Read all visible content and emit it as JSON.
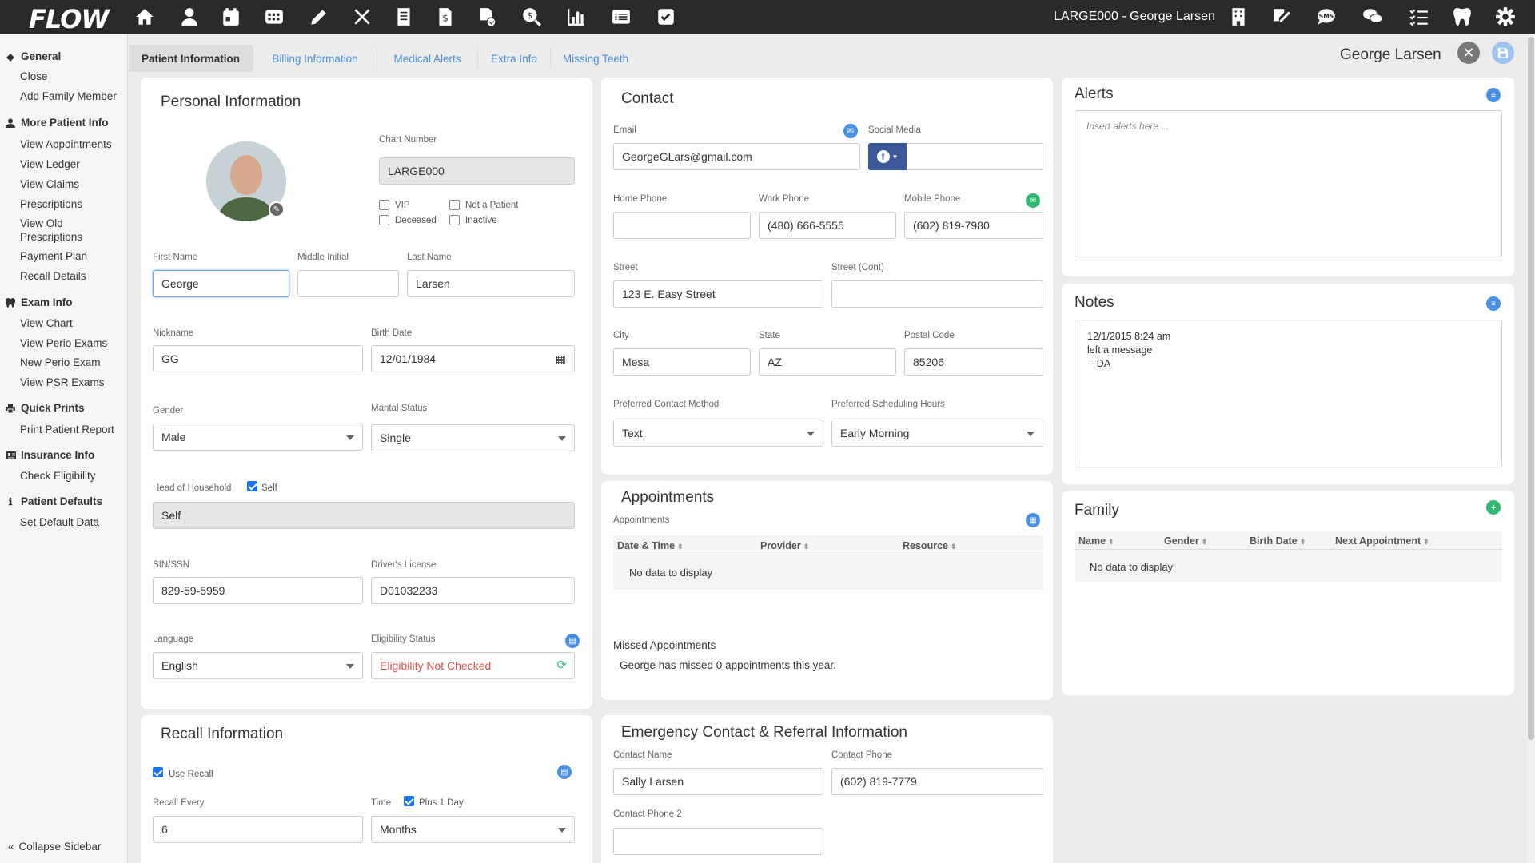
{
  "app": {
    "logo": "FLOW",
    "title": "LARGE000 - George Larsen"
  },
  "topbar_left_icons": [
    "home-icon",
    "person-icon",
    "calendar-icon",
    "schedule-grid-icon",
    "pencil-icon",
    "tools-icon",
    "ledger-icon",
    "billing-icon",
    "claims-icon",
    "search-money-icon",
    "chart-bar-icon",
    "list-icon",
    "checkbox-icon"
  ],
  "topbar_right_icons": [
    "building-icon",
    "signature-icon",
    "sms-icon",
    "chat-icon",
    "task-list-icon",
    "tooth-icon",
    "gear-icon"
  ],
  "sidebar": {
    "sections": [
      {
        "title": "General",
        "icon": "diamond-icon",
        "items": [
          "Close",
          "Add Family Member"
        ]
      },
      {
        "title": "More Patient Info",
        "icon": "user-icon",
        "items": [
          "View Appointments",
          "View Ledger",
          "View Claims",
          "Prescriptions",
          "View Old Prescriptions",
          "Payment Plan",
          "Recall Details"
        ]
      },
      {
        "title": "Exam Info",
        "icon": "tooth-icon",
        "items": [
          "View Chart",
          "View Perio Exams",
          "New Perio Exam",
          "View PSR Exams"
        ]
      },
      {
        "title": "Quick Prints",
        "icon": "printer-icon",
        "items": [
          "Print Patient Report"
        ]
      },
      {
        "title": "Insurance Info",
        "icon": "id-card-icon",
        "items": [
          "Check Eligibility"
        ]
      },
      {
        "title": "Patient Defaults",
        "icon": "info-icon",
        "items": [
          "Set Default Data"
        ]
      }
    ],
    "collapse_label": "Collapse Sidebar"
  },
  "tabs": [
    "Patient Information",
    "Billing Information",
    "Medical Alerts",
    "Extra Info",
    "Missing Teeth"
  ],
  "active_tab": 0,
  "patient_name": "George Larsen",
  "personal": {
    "title": "Personal Information",
    "chart_number_label": "Chart Number",
    "chart_number": "LARGE000",
    "checkboxes": {
      "vip": "VIP",
      "not_patient": "Not a Patient",
      "deceased": "Deceased",
      "inactive": "Inactive"
    },
    "first_name_label": "First Name",
    "first_name": "George",
    "middle_initial_label": "Middle Initial",
    "middle_initial": "",
    "last_name_label": "Last Name",
    "last_name": "Larsen",
    "nickname_label": "Nickname",
    "nickname": "GG",
    "birth_date_label": "Birth Date",
    "birth_date": "12/01/1984",
    "gender_label": "Gender",
    "gender": "Male",
    "marital_label": "Marital Status",
    "marital": "Single",
    "hoh_label": "Head of Household",
    "hoh_self_label": "Self",
    "hoh_value": "Self",
    "ssn_label": "SIN/SSN",
    "ssn": "829-59-5959",
    "license_label": "Driver's License",
    "license": "D01032233",
    "language_label": "Language",
    "language": "English",
    "eligibility_label": "Eligibility Status",
    "eligibility": "Eligibility Not Checked",
    "eligibility_color": "#d9534f"
  },
  "contact": {
    "title": "Contact",
    "email_label": "Email",
    "email": "GeorgeGLars@gmail.com",
    "social_label": "Social Media",
    "social_value": "",
    "home_phone_label": "Home Phone",
    "home_phone": "",
    "work_phone_label": "Work Phone",
    "work_phone": "(480) 666-5555",
    "mobile_phone_label": "Mobile Phone",
    "mobile_phone": "(602) 819-7980",
    "street_label": "Street",
    "street": "123 E. Easy Street",
    "street2_label": "Street (Cont)",
    "street2": "",
    "city_label": "City",
    "city": "Mesa",
    "state_label": "State",
    "state": "AZ",
    "postal_label": "Postal Code",
    "postal": "85206",
    "pref_method_label": "Preferred Contact Method",
    "pref_method": "Text",
    "pref_hours_label": "Preferred Scheduling Hours",
    "pref_hours": "Early Morning"
  },
  "alerts": {
    "title": "Alerts",
    "placeholder": "Insert alerts here ..."
  },
  "notes": {
    "title": "Notes",
    "lines": [
      "12/1/2015 8:24 am",
      "left a message",
      "-- DA"
    ]
  },
  "appointments": {
    "title": "Appointments",
    "subtitle": "Appointments",
    "columns": [
      "Date & Time",
      "Provider",
      "Resource"
    ],
    "empty": "No data to display",
    "missed_label": "Missed Appointments",
    "missed_text": "George has missed 0 appointments this year."
  },
  "family": {
    "title": "Family",
    "columns": [
      "Name",
      "Gender",
      "Birth Date",
      "Next Appointment"
    ],
    "empty": "No data to display"
  },
  "recall": {
    "title": "Recall Information",
    "use_recall_label": "Use Recall",
    "recall_every_label": "Recall Every",
    "recall_every": "6",
    "time_label": "Time",
    "plus_one_label": "Plus 1 Day",
    "time_unit": "Months"
  },
  "emergency": {
    "title": "Emergency Contact & Referral Information",
    "contact_name_label": "Contact Name",
    "contact_name": "Sally Larsen",
    "contact_phone_label": "Contact Phone",
    "contact_phone": "(602) 819-7779",
    "contact_phone2_label": "Contact Phone 2",
    "contact_phone2": ""
  },
  "colors": {
    "topbar": "#2a2a2a",
    "accent": "#4a90e2",
    "tab_link": "#4a90d9",
    "green": "#2eb872",
    "facebook": "#3b5998"
  }
}
